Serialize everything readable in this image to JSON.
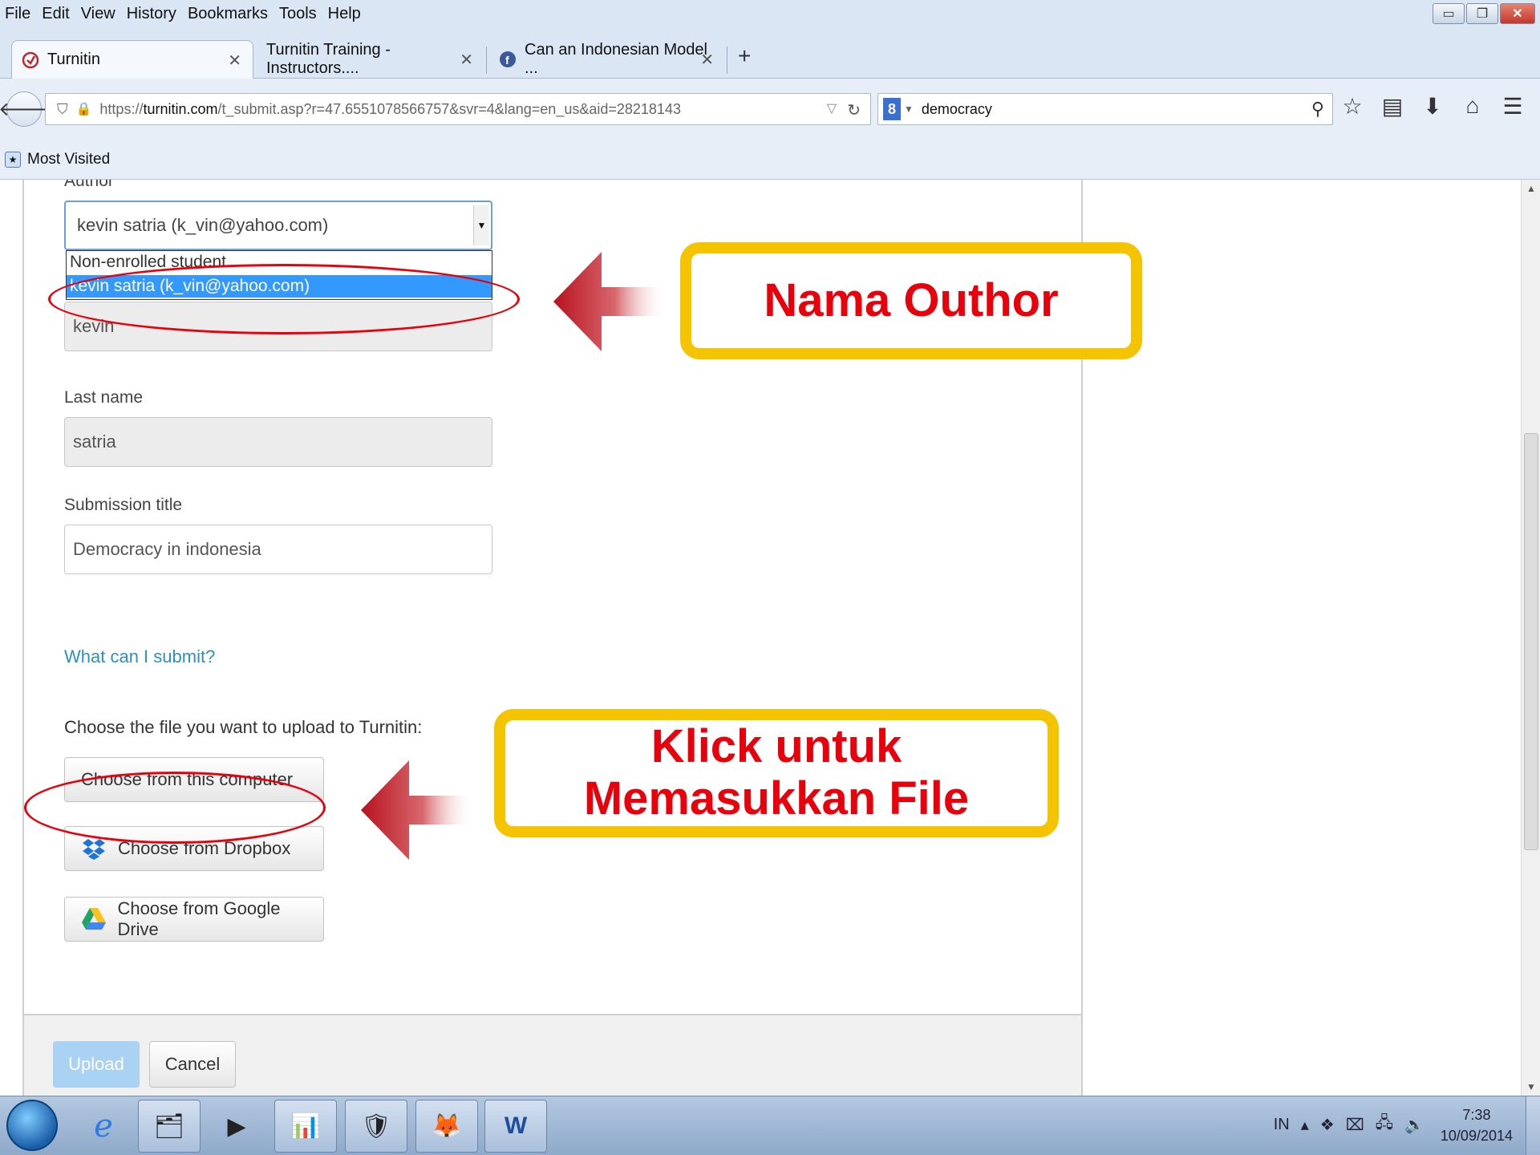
{
  "menubar": {
    "items": [
      "File",
      "Edit",
      "View",
      "History",
      "Bookmarks",
      "Tools",
      "Help"
    ]
  },
  "tabs": [
    {
      "label": "Turnitin",
      "icon": "turnitin-icon"
    },
    {
      "label": "Turnitin Training - Instructors....",
      "icon": "none"
    },
    {
      "label": "Can an Indonesian Model ...",
      "icon": "facebook-icon"
    }
  ],
  "navbar": {
    "url_prefix": "https://",
    "url_host": "turnitin.com",
    "url_path": "/t_submit.asp?r=47.6551078566757&svr=4&lang=en_us&aid=28218143",
    "search_engine": "8",
    "search_value": "democracy"
  },
  "bookmarks": {
    "most_visited": "Most Visited"
  },
  "form": {
    "author_label": "Author",
    "author_selected": "kevin satria (k_vin@yahoo.com)",
    "author_options": [
      "Non-enrolled student",
      "kevin satria (k_vin@yahoo.com)"
    ],
    "first_name_value": "kevin",
    "last_name_label": "Last name",
    "last_name_value": "satria",
    "submission_title_label": "Submission title",
    "submission_title_value": "Democracy in indonesia",
    "what_can_submit": "What can I submit?",
    "choose_file_label": "Choose the file you want to upload to Turnitin:",
    "choose_computer": "Choose from this computer",
    "choose_dropbox": "Choose from Dropbox",
    "choose_gdrive": "Choose from Google Drive",
    "upload": "Upload",
    "cancel": "Cancel"
  },
  "annotations": {
    "callout_author": "Nama Outhor",
    "callout_file_line1": "Klick untuk",
    "callout_file_line2": "Memasukkan File",
    "accent_red": "#e8000b",
    "accent_yellow": "#f5c400"
  },
  "taskbar": {
    "language": "IN",
    "time": "7:38",
    "date": "10/09/2014"
  }
}
